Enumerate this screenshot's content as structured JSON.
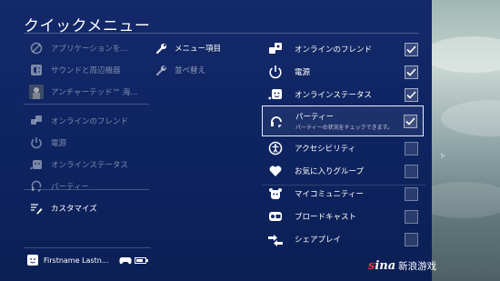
{
  "title": "クイックメニュー",
  "col1": {
    "items": [
      {
        "label": "アプリケーションを...",
        "icon": "cancel-icon"
      },
      {
        "label": "サウンドと周辺機器",
        "icon": "sound-icon"
      },
      {
        "label": "アンチャーテッド™ 海...",
        "icon": "game-thumbnail-icon"
      },
      {
        "label": "オンラインのフレンド",
        "icon": "friends-icon"
      },
      {
        "label": "電源",
        "icon": "power-icon"
      },
      {
        "label": "オンラインステータス",
        "icon": "status-icon"
      },
      {
        "label": "パーティー",
        "icon": "party-icon"
      },
      {
        "label": "カスタマイズ",
        "icon": "customize-icon"
      }
    ]
  },
  "col2": {
    "items": [
      {
        "label": "メニュー項目",
        "icon": "wrench-icon"
      },
      {
        "label": "並べ替え",
        "icon": "wrench-icon"
      }
    ]
  },
  "col3": {
    "items": [
      {
        "label": "オンラインのフレンド",
        "checked": true,
        "icon": "friends-icon"
      },
      {
        "label": "電源",
        "checked": true,
        "icon": "power-icon"
      },
      {
        "label": "オンラインステータス",
        "checked": true,
        "icon": "status-icon"
      },
      {
        "label": "パーティー",
        "sub": "パーティーの状況をチェックできます。",
        "checked": true,
        "icon": "party-icon"
      },
      {
        "label": "アクセシビリティ",
        "checked": false,
        "icon": "accessibility-icon"
      },
      {
        "label": "お気に入りグループ",
        "checked": false,
        "icon": "heart-icon"
      },
      {
        "label": "マイコミュニティー",
        "checked": false,
        "icon": "community-icon"
      },
      {
        "label": "ブロードキャスト",
        "checked": false,
        "icon": "broadcast-icon"
      },
      {
        "label": "シェアプレイ",
        "checked": false,
        "icon": "shareplay-icon"
      }
    ]
  },
  "footer": {
    "user": "Firstname Lastn...",
    "controller_icon": "controller-icon",
    "battery": 0.8
  },
  "background": {
    "tag": "ト"
  },
  "watermark": {
    "logo_a": "s",
    "logo_b": "ina",
    "text": "新浪游戏"
  },
  "colors": {
    "panel": "#13296a",
    "focus_border": "#e8eef8"
  }
}
